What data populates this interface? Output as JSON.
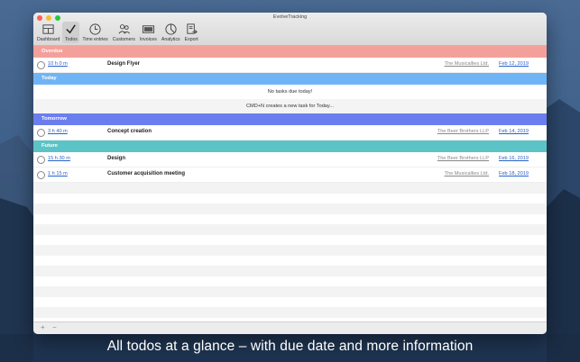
{
  "window": {
    "title": "EvolveTracking"
  },
  "toolbar": [
    {
      "label": "Dashboard",
      "icon": "dashboard-icon"
    },
    {
      "label": "Todos",
      "icon": "checkmark-icon"
    },
    {
      "label": "Time entries",
      "icon": "clock-icon"
    },
    {
      "label": "Customers",
      "icon": "customers-icon"
    },
    {
      "label": "Invoices",
      "icon": "invoice-icon"
    },
    {
      "label": "Analytics",
      "icon": "analytics-icon"
    },
    {
      "label": "Export",
      "icon": "export-icon"
    }
  ],
  "sections": {
    "overdue": {
      "title": "Overdue",
      "color": "#f4a09a"
    },
    "today": {
      "title": "Today",
      "color": "#6fb5f5"
    },
    "tomorrow": {
      "title": "Tomorrow",
      "color": "#6b7ef0"
    },
    "future": {
      "title": "Future",
      "color": "#5cc4c6"
    }
  },
  "overdue_tasks": [
    {
      "duration": "10 h 0 m",
      "name": "Design Flyer",
      "client": "The Musicallies Ltd.",
      "due": "Feb 12, 2019"
    }
  ],
  "today_messages": {
    "none": "No tasks due today!",
    "hint": "CMD+N creates a new task for Today..."
  },
  "tomorrow_tasks": [
    {
      "duration": "3 h 40 m",
      "name": "Concept creation",
      "client": "The Beer Brothers LLP",
      "due": "Feb 14, 2019"
    }
  ],
  "future_tasks": [
    {
      "duration": "15 h 30 m",
      "name": "Design",
      "client": "The Beer Brothers LLP",
      "due": "Feb 16, 2019"
    },
    {
      "duration": "1 h 15 m",
      "name": "Customer acquisition meeting",
      "client": "The Musicallies Ltd.",
      "due": "Feb 18, 2019"
    }
  ],
  "bottombar": {
    "add": "+",
    "remove": "−"
  },
  "caption": "All todos at a glance – with due date and more information"
}
